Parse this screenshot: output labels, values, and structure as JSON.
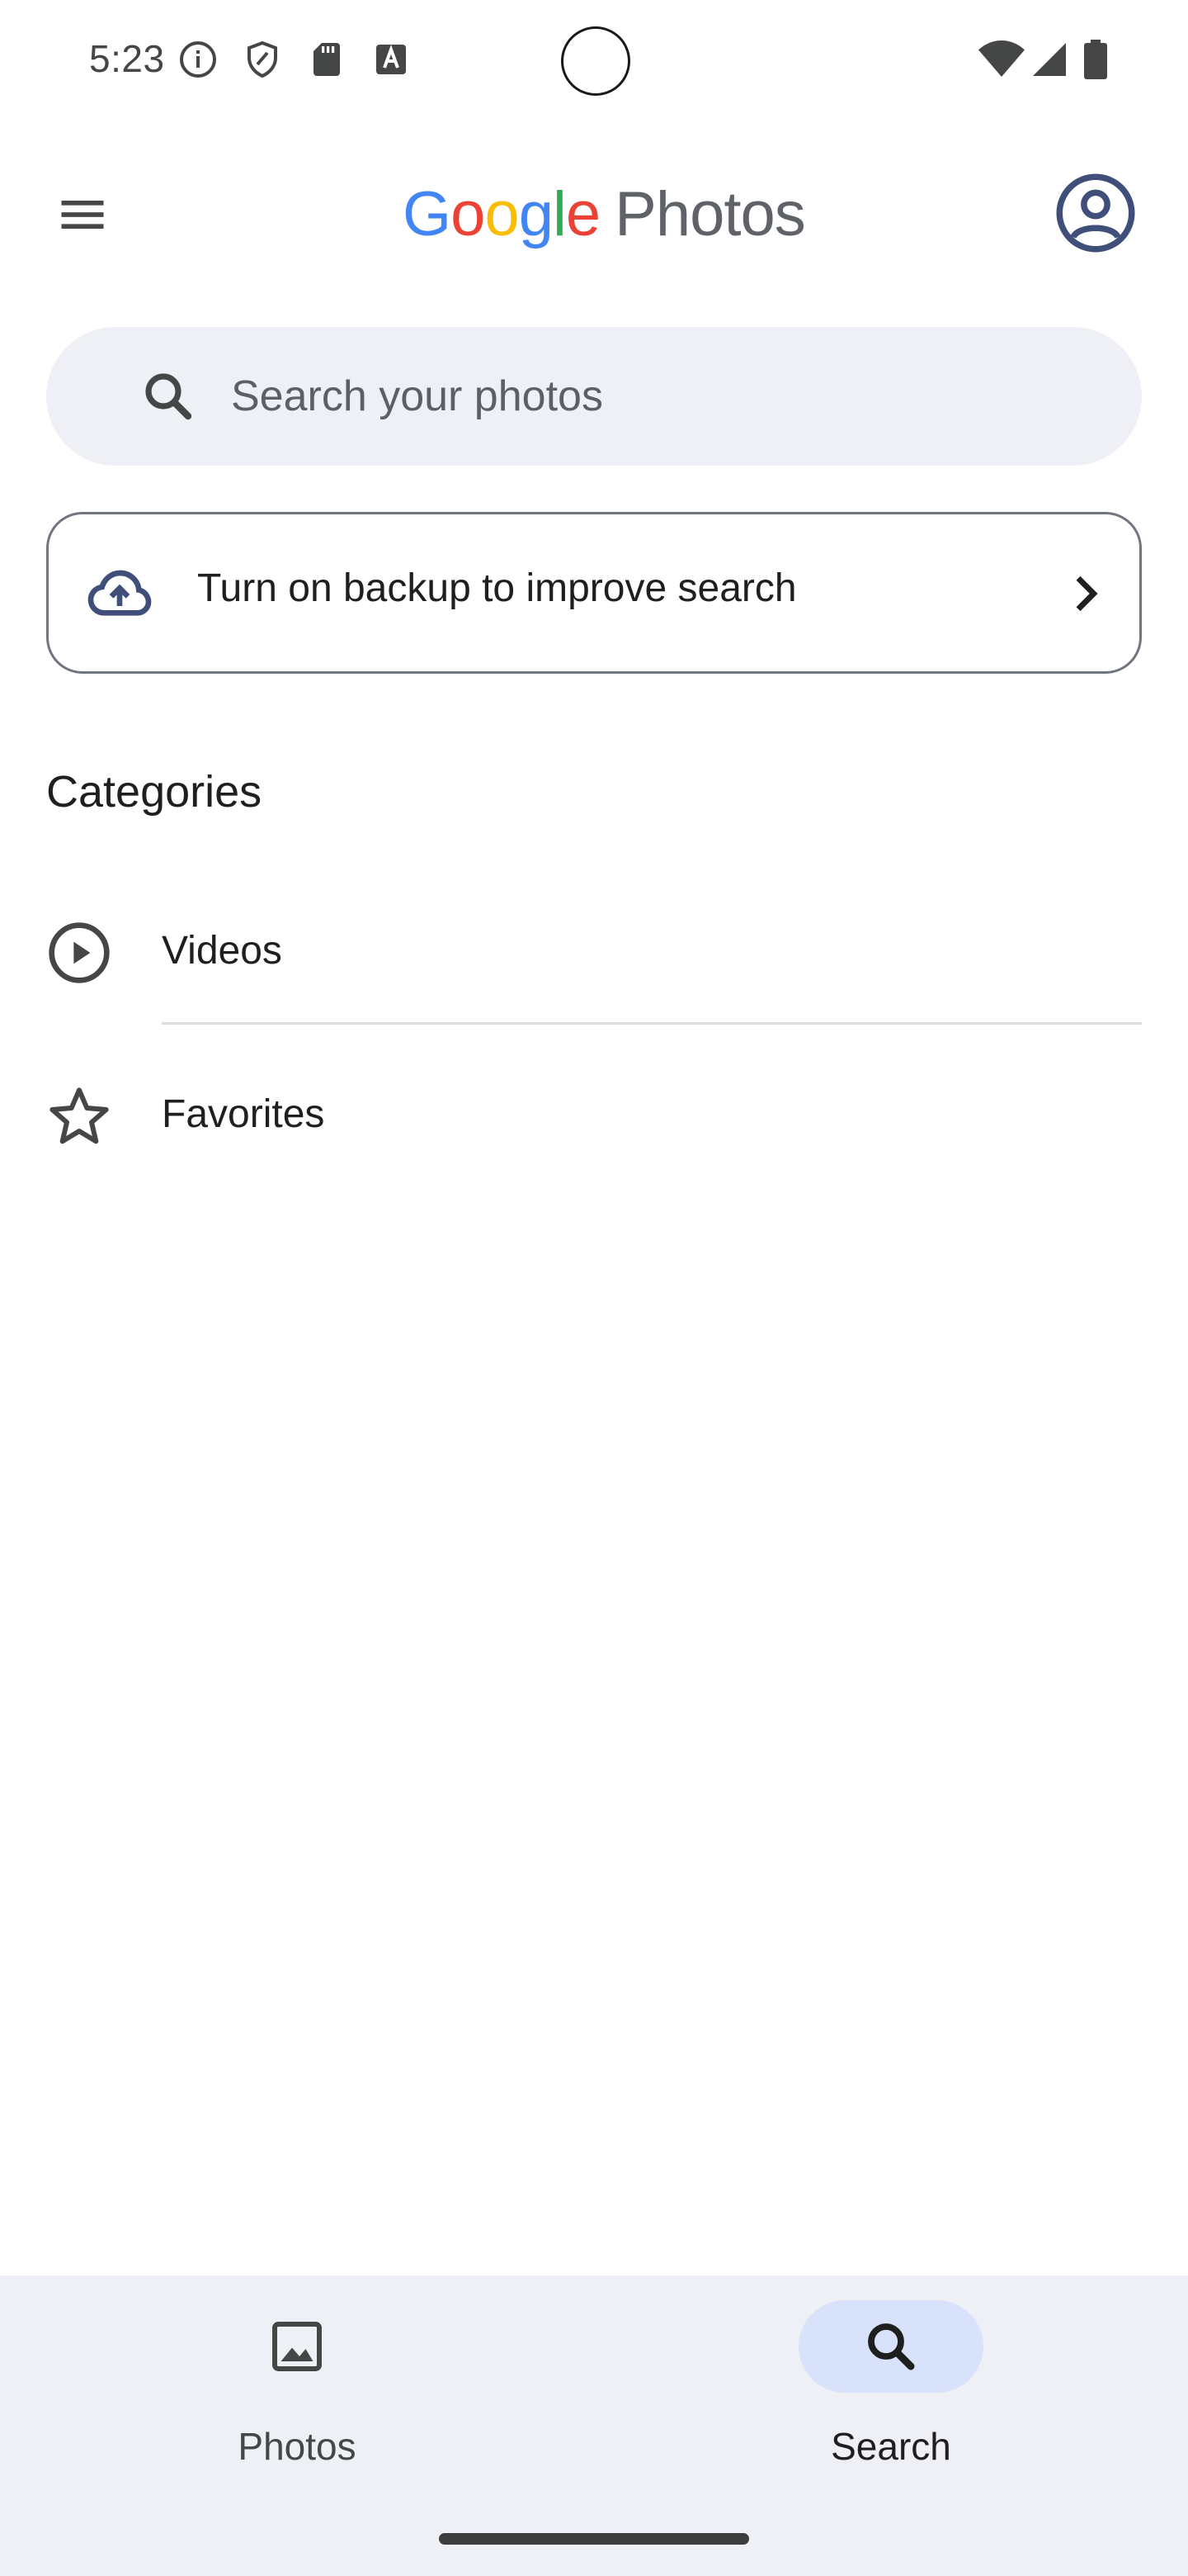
{
  "status_bar": {
    "time": "5:23",
    "left_icons": [
      "info-icon",
      "vpn-shield-icon",
      "sd-card-icon",
      "accessibility-a-icon"
    ],
    "right_icons": [
      "wifi-icon",
      "cell-signal-icon",
      "battery-icon"
    ]
  },
  "app_bar": {
    "logo_letters": [
      "G",
      "o",
      "o",
      "g",
      "l",
      "e"
    ],
    "logo_product": "Photos",
    "menu_icon": "hamburger-menu-icon",
    "account_icon": "account-circle-icon"
  },
  "search": {
    "placeholder": "Search your photos",
    "icon": "search-icon"
  },
  "backup_card": {
    "label": "Turn on backup to improve search",
    "icon": "cloud-upload-icon",
    "trailing_icon": "chevron-right-icon"
  },
  "categories": {
    "title": "Categories",
    "items": [
      {
        "label": "Videos",
        "icon": "play-circle-icon"
      },
      {
        "label": "Favorites",
        "icon": "star-outline-icon"
      }
    ]
  },
  "bottom_nav": {
    "items": [
      {
        "label": "Photos",
        "icon": "photo-icon",
        "selected": false
      },
      {
        "label": "Search",
        "icon": "search-icon",
        "selected": true
      }
    ]
  },
  "colors": {
    "accent_pill": "#d9e2fb",
    "surface": "#eef0f5",
    "google_blue": "#4285f4",
    "google_red": "#ea4335",
    "google_yellow": "#fbbc04",
    "google_green": "#34a853"
  }
}
